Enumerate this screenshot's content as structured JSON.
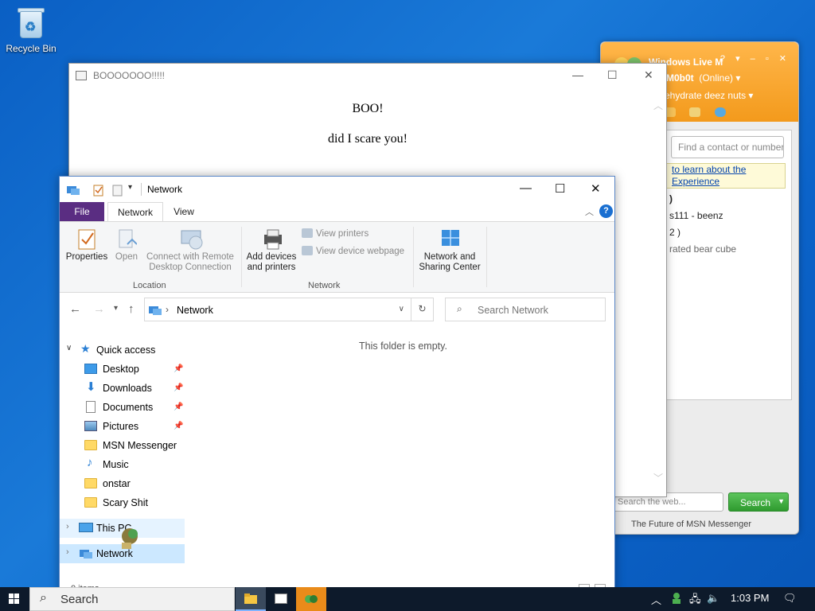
{
  "desktop": {
    "recycle_bin_label": "Recycle Bin"
  },
  "msn": {
    "title": "Windows Live M",
    "user_name": "M0b0t",
    "user_status": "(Online)",
    "personal_message": "ehydrate deez nuts",
    "find_placeholder": "Find a contact or number",
    "ad_line_1": "to learn about the",
    "ad_line_2": "Experience",
    "contacts": [
      ")",
      "s111 - beenz",
      "2 )",
      "rated bear cube"
    ],
    "search_placeholder": "Search the web...",
    "search_button": "Search",
    "footer": "The Future of MSN Messenger"
  },
  "boo_window": {
    "title": "BOOOOOOO!!!!!",
    "heading": "BOO!",
    "subtext": "did I scare you!"
  },
  "explorer": {
    "title": "Network",
    "tabs": [
      "File",
      "Network",
      "View"
    ],
    "ribbon": {
      "properties": "Properties",
      "open": "Open",
      "connect_remote": "Connect with Remote Desktop Connection",
      "location_group": "Location",
      "add_devices": "Add devices and printers",
      "view_printers": "View printers",
      "view_device_webpage": "View device webpage",
      "network_group": "Network",
      "network_sharing": "Network and Sharing Center"
    },
    "address": "Network",
    "search_placeholder": "Search Network",
    "empty_message": "This folder is empty.",
    "nav": {
      "quick_access": "Quick access",
      "items": [
        "Desktop",
        "Downloads",
        "Documents",
        "Pictures",
        "MSN Messenger",
        "Music",
        "onstar",
        "Scary Shit"
      ],
      "this_pc": "This PC",
      "network": "Network"
    },
    "status_text": "0 items"
  },
  "taskbar": {
    "search_label": "Search",
    "time": "1:03 PM"
  },
  "colors": {
    "desktop_bg": "#0a5fc4",
    "file_tab": "#5a2d82",
    "msn_orange": "#f39a1c",
    "nav_selected": "#cce8ff"
  }
}
